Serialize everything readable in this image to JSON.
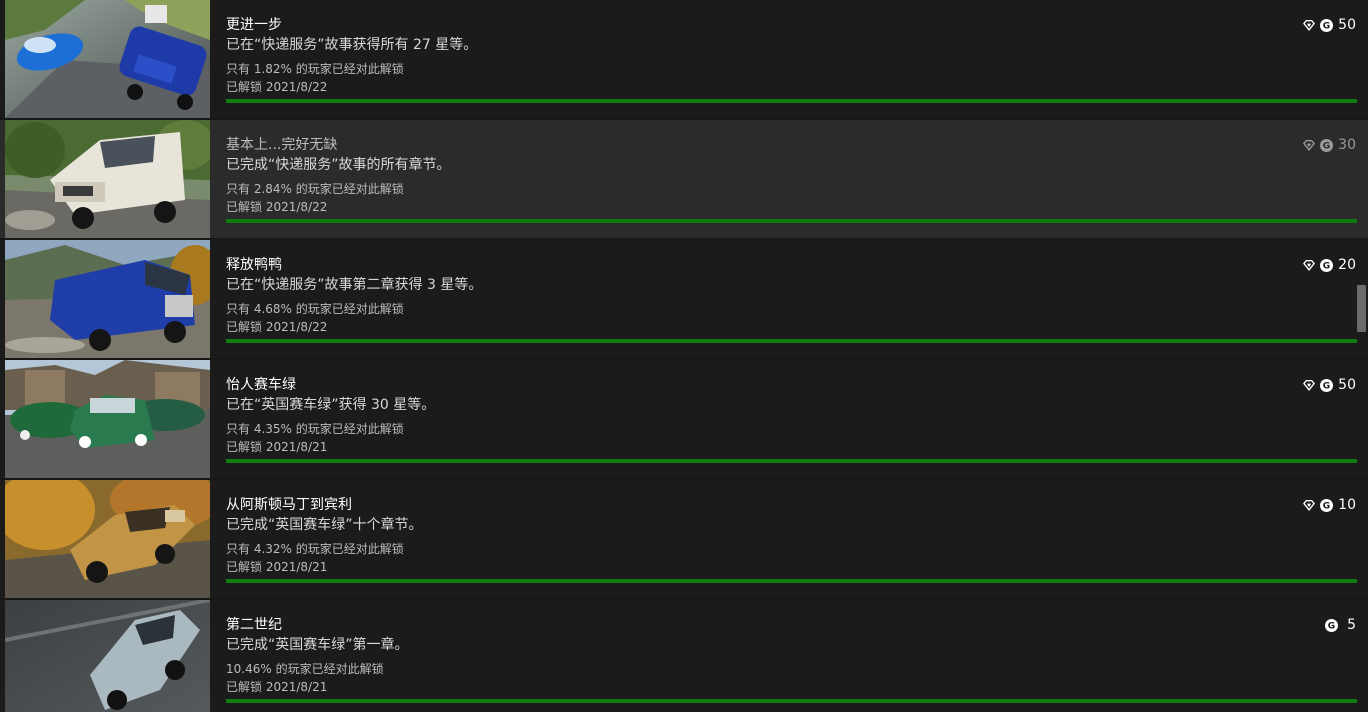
{
  "achievements": [
    {
      "title": "更进一步",
      "description": "已在“快递服务”故事获得所有 27 星等。",
      "rarity": "只有 1.82% 的玩家已经对此解锁",
      "unlocked": "已解锁 2021/8/22",
      "gamerscore": "50",
      "has_rare_icon": true,
      "progress": 1.0,
      "image": "blue-cars-racing"
    },
    {
      "title": "基本上...完好无缺",
      "description": "已完成“快递服务”故事的所有章节。",
      "rarity": "只有 2.84% 的玩家已经对此解锁",
      "unlocked": "已解锁 2021/8/22",
      "gamerscore": "30",
      "has_rare_icon": true,
      "progress": 1.0,
      "selected": true,
      "image": "white-van"
    },
    {
      "title": "释放鸭鸭",
      "description": "已在“快递服务”故事第二章获得 3 星等。",
      "rarity": "只有 4.68% 的玩家已经对此解锁",
      "unlocked": "已解锁 2021/8/22",
      "gamerscore": "20",
      "has_rare_icon": true,
      "progress": 1.0,
      "image": "blue-van"
    },
    {
      "title": "怡人赛车绿",
      "description": "已在“英国赛车绿”获得 30 星等。",
      "rarity": "只有 4.35% 的玩家已经对此解锁",
      "unlocked": "已解锁 2021/8/21",
      "gamerscore": "50",
      "has_rare_icon": true,
      "progress": 1.0,
      "image": "green-cars"
    },
    {
      "title": "从阿斯顿马丁到宾利",
      "description": "已完成“英国赛车绿”十个章节。",
      "rarity": "只有 4.32% 的玩家已经对此解锁",
      "unlocked": "已解锁 2021/8/21",
      "gamerscore": "10",
      "has_rare_icon": true,
      "progress": 1.0,
      "image": "gold-car-autumn"
    },
    {
      "title": "第二世纪",
      "description": "已完成“英国赛车绿”第一章。",
      "rarity": "10.46% 的玩家已经对此解锁",
      "unlocked": "已解锁 2021/8/21",
      "gamerscore": "5",
      "has_rare_icon": false,
      "progress": 1.0,
      "image": "silver-classic-car"
    }
  ],
  "colors": {
    "background": "#171717",
    "row": "#1b1b1b",
    "row_selected": "#2b2b2b",
    "progress": "#107c10"
  }
}
